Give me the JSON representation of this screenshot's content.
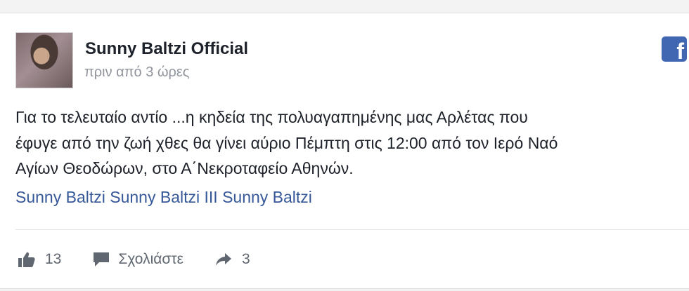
{
  "post": {
    "page_name": "Sunny Baltzi Official",
    "timestamp": "πριν από 3 ώρες",
    "logo_icon": "facebook-logo-icon",
    "text_lines": [
      "Για το τελευταίο αντίο ...η κηδεία της πολυαγαπημένης μας Αρλέτας που",
      "έφυγε από την ζωή χθες θα γίνει αύριο Πέμπτη στις 12:00 από τον Ιερό Ναό",
      "Αγίων Θεοδώρων, στο Α΄Νεκροταφείο Αθηνών."
    ],
    "links": [
      "Sunny Baltzi",
      "Sunny Baltzi III",
      "Sunny Baltzi"
    ]
  },
  "actions": {
    "likes": "13",
    "comment_label": "Σχολιάστε",
    "shares": "3"
  },
  "colors": {
    "text": "#1d2129",
    "muted": "#90949c",
    "link": "#365899",
    "facebook_blue": "#4267b2",
    "action_grey": "#606770"
  }
}
